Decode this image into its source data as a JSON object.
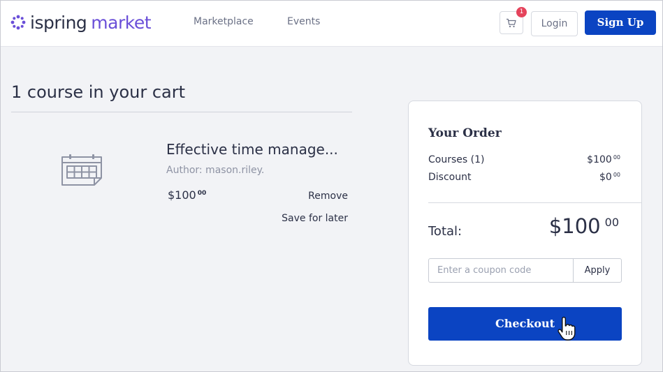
{
  "brand": {
    "name_part1": "ispring",
    "name_part2": "market",
    "accent_color": "#6a4fd8",
    "primary_color": "#0b44c2"
  },
  "header": {
    "nav": [
      {
        "label": "Marketplace"
      },
      {
        "label": "Events"
      }
    ],
    "cart_icon": "shopping-cart-icon",
    "cart_badge": "1",
    "login_label": "Login",
    "signup_label": "Sign Up"
  },
  "cart": {
    "heading": "1 course in your cart",
    "items": [
      {
        "icon": "calendar-icon",
        "title": "Effective time manage...",
        "author": "Author: mason.riley.",
        "price_main": "$100",
        "price_cents": "00",
        "remove_label": "Remove",
        "save_label": "Save for later"
      }
    ]
  },
  "order": {
    "title": "Your Order",
    "rows": [
      {
        "label": "Courses (1)",
        "value_main": "$100",
        "value_cents": "00"
      },
      {
        "label": "Discount",
        "value_main": "$0",
        "value_cents": "00"
      }
    ],
    "total_label": "Total:",
    "total_main": "$100",
    "total_cents": "00",
    "coupon_placeholder": "Enter a coupon code",
    "coupon_value": "",
    "apply_label": "Apply",
    "checkout_label": "Checkout"
  }
}
